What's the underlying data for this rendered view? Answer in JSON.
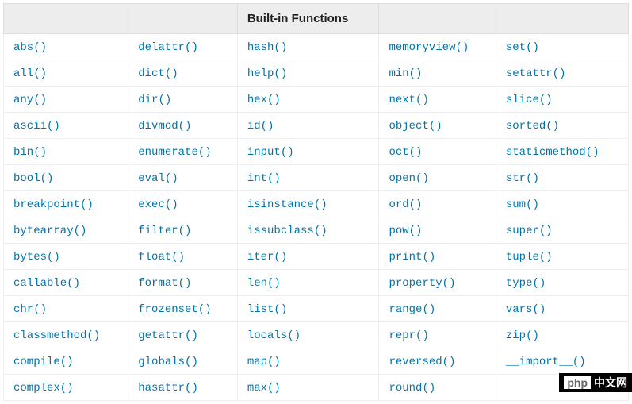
{
  "header": {
    "col1": "",
    "col2": "",
    "col3": "Built-in Functions",
    "col4": "",
    "col5": ""
  },
  "rows": [
    [
      "abs()",
      "delattr()",
      "hash()",
      "memoryview()",
      "set()"
    ],
    [
      "all()",
      "dict()",
      "help()",
      "min()",
      "setattr()"
    ],
    [
      "any()",
      "dir()",
      "hex()",
      "next()",
      "slice()"
    ],
    [
      "ascii()",
      "divmod()",
      "id()",
      "object()",
      "sorted()"
    ],
    [
      "bin()",
      "enumerate()",
      "input()",
      "oct()",
      "staticmethod()"
    ],
    [
      "bool()",
      "eval()",
      "int()",
      "open()",
      "str()"
    ],
    [
      "breakpoint()",
      "exec()",
      "isinstance()",
      "ord()",
      "sum()"
    ],
    [
      "bytearray()",
      "filter()",
      "issubclass()",
      "pow()",
      "super()"
    ],
    [
      "bytes()",
      "float()",
      "iter()",
      "print()",
      "tuple()"
    ],
    [
      "callable()",
      "format()",
      "len()",
      "property()",
      "type()"
    ],
    [
      "chr()",
      "frozenset()",
      "list()",
      "range()",
      "vars()"
    ],
    [
      "classmethod()",
      "getattr()",
      "locals()",
      "repr()",
      "zip()"
    ],
    [
      "compile()",
      "globals()",
      "map()",
      "reversed()",
      "__import__()"
    ],
    [
      "complex()",
      "hasattr()",
      "max()",
      "round()",
      ""
    ]
  ],
  "watermark": {
    "php": "php",
    "cn": "中文网"
  }
}
